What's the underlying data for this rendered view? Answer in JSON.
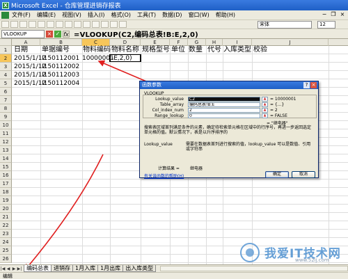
{
  "window": {
    "title": "Microsoft Excel - 仓库管理进销存报表"
  },
  "menu": [
    "文件(F)",
    "编辑(E)",
    "视图(V)",
    "插入(I)",
    "格式(O)",
    "工具(T)",
    "数据(D)",
    "窗口(W)",
    "帮助(H)"
  ],
  "toolbar": {
    "font": "宋体",
    "size": "12"
  },
  "formula_bar": {
    "name_box": "VLOOKUP",
    "formula": "=VLOOKUP(C2,编码总表!B:E,2,0)",
    "cancel_icon": "×",
    "enter_icon": "✓",
    "fx_icon": "fx"
  },
  "columns": [
    "A",
    "B",
    "C",
    "D",
    "E",
    "F",
    "G",
    "H",
    "I",
    "J"
  ],
  "rows": [
    "1",
    "2",
    "3",
    "4",
    "5",
    "6",
    "7",
    "8",
    "9",
    "10",
    "11",
    "12",
    "13",
    "14",
    "15",
    "16",
    "17",
    "18",
    "19",
    "20",
    "21",
    "22",
    "23",
    "24",
    "25",
    "26"
  ],
  "sheet": {
    "headers": [
      "日期",
      "单据编号",
      "物料编码",
      "物料名称",
      "规格型号",
      "单位",
      "数量",
      "代号",
      "入库类型",
      "校验"
    ],
    "data": [
      {
        "date": "2015/1/12",
        "doc": "I150112001",
        "code": "10000001",
        "name": "-E,2,0)"
      },
      {
        "date": "2015/1/12",
        "doc": "I150112002"
      },
      {
        "date": "2015/1/12",
        "doc": "I150112003"
      },
      {
        "date": "2015/1/12",
        "doc": "I150112004"
      }
    ]
  },
  "dialog": {
    "title": "函数参数",
    "help_icon": "?",
    "close_icon": "×",
    "function_name": "VLOOKUP",
    "args": [
      {
        "label": "Lookup_value",
        "value": "C2",
        "result": "= 10000001"
      },
      {
        "label": "Table_array",
        "value": "编码总表!B:E",
        "result": "= {...}"
      },
      {
        "label": "Col_index_num",
        "value": "2",
        "result": "= 2"
      },
      {
        "label": "Range_lookup",
        "value": "0",
        "result": "= FALSE"
      }
    ],
    "formula_result": "= \"继电器\"",
    "description": "搜索表区域首列满足条件的元素，确定待检索单元格在区域中的行序号，再进一步返回选定单元格的值。默认情况下，表是以升序排序的",
    "arg_help_label": "Lookup_value",
    "arg_help_text": "需要在数据表首列进行搜索的值，lookup_value 可以是数值、引用或字符串",
    "calc_label": "计算结果 =",
    "calc_value": "继电器",
    "help_link": "有关该函数的帮助(H)",
    "ok_label": "确定",
    "cancel_label": "取消",
    "pick_icon": "▲"
  },
  "tabs": [
    "编码总表",
    "进销存",
    "1月入库",
    "1月出库",
    "出入库类型"
  ],
  "tab_nav": [
    "|◀",
    "◀",
    "▶",
    "▶|"
  ],
  "status": "编辑",
  "watermark": {
    "text": "我爱IT技术网",
    "url": "www.52ij.com"
  },
  "colors": {
    "accent": "#1f5fc6",
    "arrow": "#e02020",
    "active_header": "#f7c65a"
  }
}
